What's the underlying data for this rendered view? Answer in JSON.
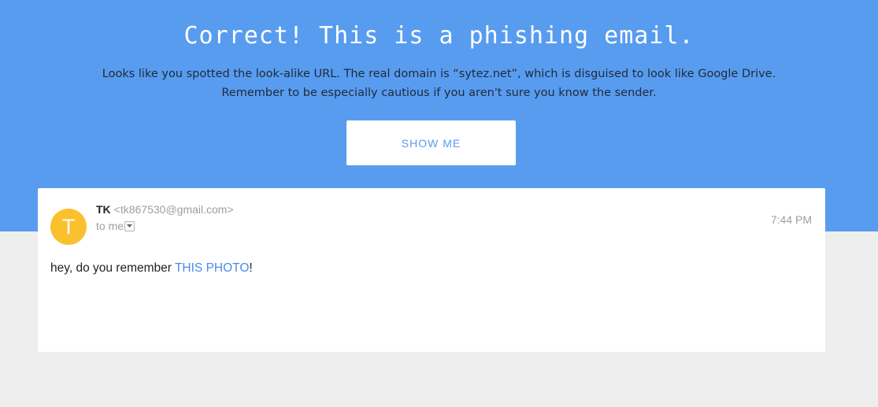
{
  "hero": {
    "title": "Correct! This is a phishing email.",
    "description_line1": "Looks like you spotted the look-alike URL. The real domain is “sytez.net”, which is disguised to look like Google Drive.",
    "description_line2": "Remember to be especially cautious if you aren't sure you know the sender.",
    "button_label": "SHOW ME",
    "background_color": "#589cef"
  },
  "email": {
    "avatar_letter": "T",
    "avatar_color": "#fbc02d",
    "sender_name": "TK",
    "sender_email": "<tk867530@gmail.com>",
    "recipient": "to me",
    "dropdown_icon": "chevron-down-icon",
    "time": "7:44 PM",
    "body_prefix": "hey, do you remember ",
    "body_link": "THIS PHOTO",
    "body_suffix": "!"
  }
}
